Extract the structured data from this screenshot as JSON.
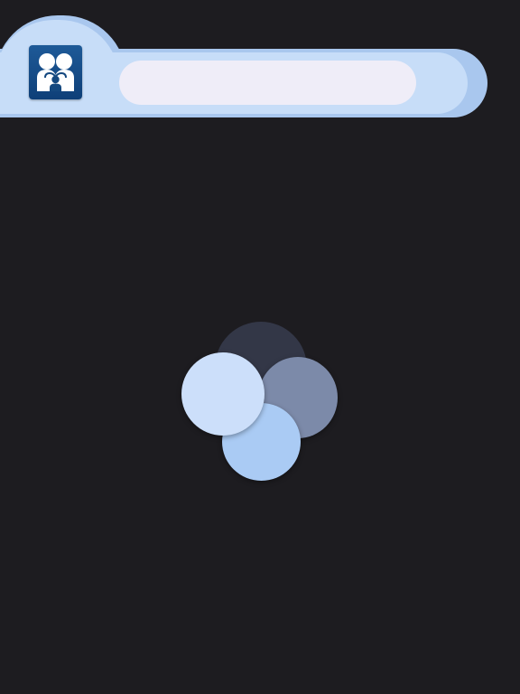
{
  "header": {
    "app_icon": "family-app-icon",
    "search": {
      "value": "",
      "placeholder": ""
    }
  },
  "loader": {
    "icon": "loading-indicator-icon",
    "state": "loading"
  },
  "colors": {
    "background": "#1d1c20",
    "header_outer": "#a9c7ee",
    "header_inner": "#c7ddf8",
    "search_field": "#efedf8",
    "icon_blue": "#1e5a98",
    "loader_dark": "#333747",
    "loader_slate": "#7c8aa9",
    "loader_blue": "#aacbf4",
    "loader_light": "#ccdffa"
  }
}
